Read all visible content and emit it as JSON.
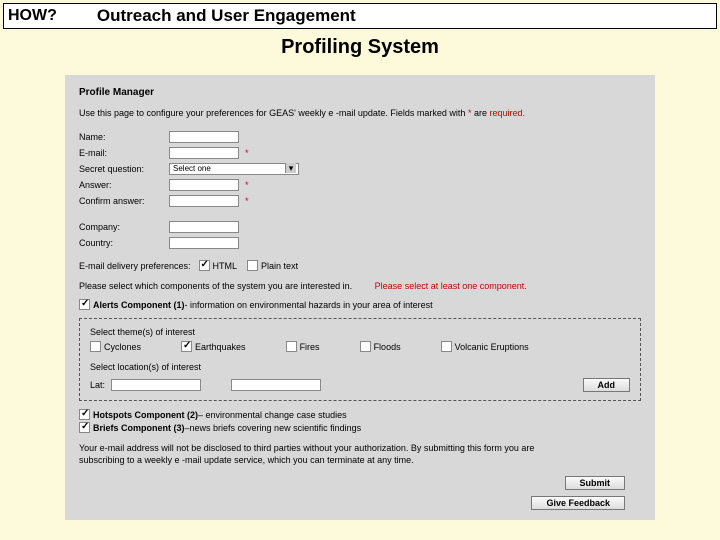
{
  "banner": {
    "how": "HOW?",
    "title": "Outreach and User Engagement"
  },
  "subtitle": "Profiling System",
  "panel": {
    "header": "Profile Manager",
    "intro_a": "Use this page to configure your preferences for GEAS' weekly e",
    "intro_b": "-mail update. Fields marked with ",
    "intro_star": "*",
    "intro_c": " are ",
    "intro_req": "required.",
    "fields": {
      "name": "Name:",
      "email": "E-mail:",
      "secret": "Secret question:",
      "secret_opt": "Select one",
      "answer": "Answer:",
      "confirm": "Confirm answer:",
      "company": "Company:",
      "country": "Country:"
    },
    "pref_label": "E-mail delivery preferences:",
    "pref_html": "HTML",
    "pref_plain": "Plain text",
    "comp_select": "Please select which components of the system you are interested in.",
    "comp_select_sub": "Please select at least one component.",
    "comp1_a": "Alerts Component (1) ",
    "comp1_b": "- information on environmental hazards in your area of interest",
    "themes_label": "Select theme(s) of interest",
    "themes": {
      "cyclones": "Cyclones",
      "earthquakes": "Earthquakes",
      "fires": "Fires",
      "floods": "Floods",
      "volcanic": "Volcanic Eruptions"
    },
    "loc_label": "Select location(s) of interest",
    "lat": "Lat:",
    "add_btn": "Add",
    "comp2_a": "Hotspots Component (2)",
    "comp2_b": " – environmental change case studies",
    "comp3_a": "Briefs Component (3) ",
    "comp3_b": "–news briefs covering new scientific findings",
    "disclaimer": "Your e-mail address will not be disclosed to third parties without your authorization. By submitting this form you are subscribing to a weekly e -mail update service, which you can terminate at any time.",
    "submit": "Submit",
    "feedback": "Give Feedback"
  }
}
